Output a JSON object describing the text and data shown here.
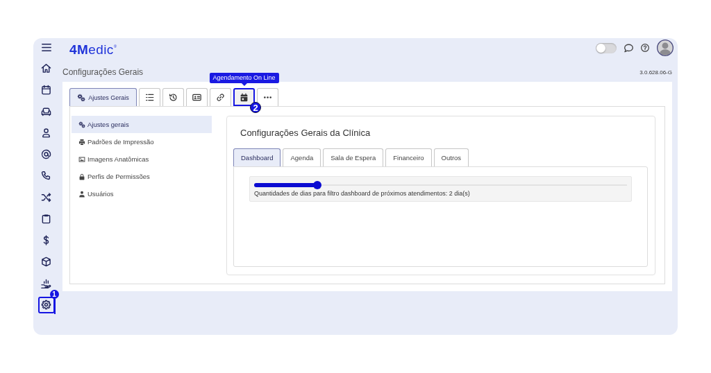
{
  "topbar": {
    "logo": "**4M**edic$^{®}$",
    "toggle": {
      "on": false
    }
  },
  "sidebar": {
    "items": [
      {
        "highlighted": false
      },
      {
        "highlighted": false
      },
      {
        "highlighted": false
      },
      {
        "highlighted": false
      },
      {
        "highlighted": false
      },
      {
        "highlighted": false
      },
      {
        "highlighted": false
      },
      {
        "highlighted": false
      },
      {
        "highlighted": false
      },
      {
        "highlighted": false
      },
      {
        "highlighted": false
      },
      {
        "highlighted": true,
        "callout": "1"
      }
    ]
  },
  "header": {
    "title": "Configurações Gerais",
    "version": "3.0.628.06-G"
  },
  "toolbar_tabs": [
    {
      "kind": "labeled",
      "label": "Ajustes Gerais",
      "selected": true,
      "highlighted": false
    },
    {
      "kind": "icon",
      "selected": false,
      "highlighted": false
    },
    {
      "kind": "icon",
      "selected": false,
      "highlighted": false
    },
    {
      "kind": "icon",
      "selected": false,
      "highlighted": false
    },
    {
      "kind": "icon",
      "selected": false,
      "highlighted": false
    },
    {
      "kind": "icon",
      "selected": false,
      "highlighted": true,
      "tooltip": "Agendamento On Line",
      "callout": "2"
    },
    {
      "kind": "icon",
      "selected": false,
      "highlighted": false
    }
  ],
  "submenu": {
    "items": [
      {
        "label": "Ajustes gerais",
        "selected": true
      },
      {
        "label": "Padrões de Impressão",
        "selected": false
      },
      {
        "label": "Imagens Anatômicas",
        "selected": false
      },
      {
        "label": "Perfis de Permissões",
        "selected": false
      },
      {
        "label": "Usuários",
        "selected": false
      }
    ]
  },
  "card": {
    "title": "Configurações Gerais da Clínica",
    "tabs": [
      {
        "label": "Dashboard",
        "selected": true
      },
      {
        "label": "Agenda",
        "selected": false
      },
      {
        "label": "Sala de Espera",
        "selected": false
      },
      {
        "label": "Financeiro",
        "selected": false
      },
      {
        "label": "Outros",
        "selected": false
      }
    ],
    "settings": [
      {
        "kind": "slider",
        "level": 0.17,
        "label": "Quantidades de dias para filtro dashboard de próximos atendimentos: 2 dia(s)"
      }
    ]
  }
}
